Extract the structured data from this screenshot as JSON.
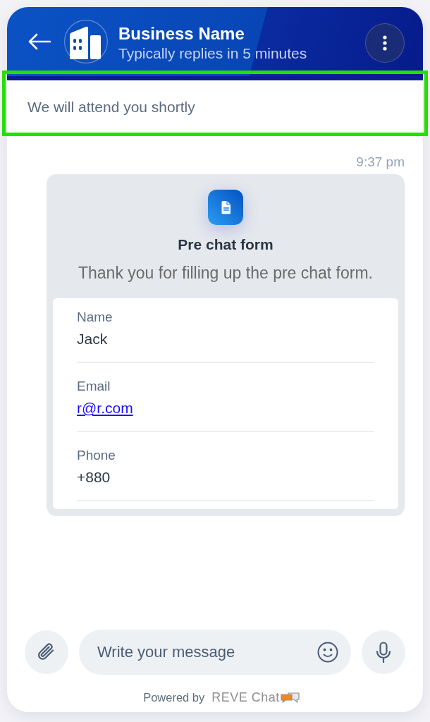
{
  "header": {
    "title": "Business Name",
    "subtitle": "Typically replies in 5 minutes"
  },
  "notice": {
    "text": "We will attend you shortly",
    "highlighted": true
  },
  "messages": [
    {
      "kind": "form_card",
      "time": "9:37 pm",
      "title": "Pre chat form",
      "description": "Thank you for filling up the pre chat form.",
      "fields": [
        {
          "kind": "text",
          "label": "Name",
          "value": "Jack"
        },
        {
          "kind": "link",
          "label": "Email",
          "value": "r@r.com"
        },
        {
          "kind": "text",
          "label": "Phone",
          "value": "+880"
        }
      ]
    }
  ],
  "composer": {
    "placeholder": "Write your message"
  },
  "footer": {
    "powered_by": "Powered by",
    "brand": "REVE Chat"
  }
}
